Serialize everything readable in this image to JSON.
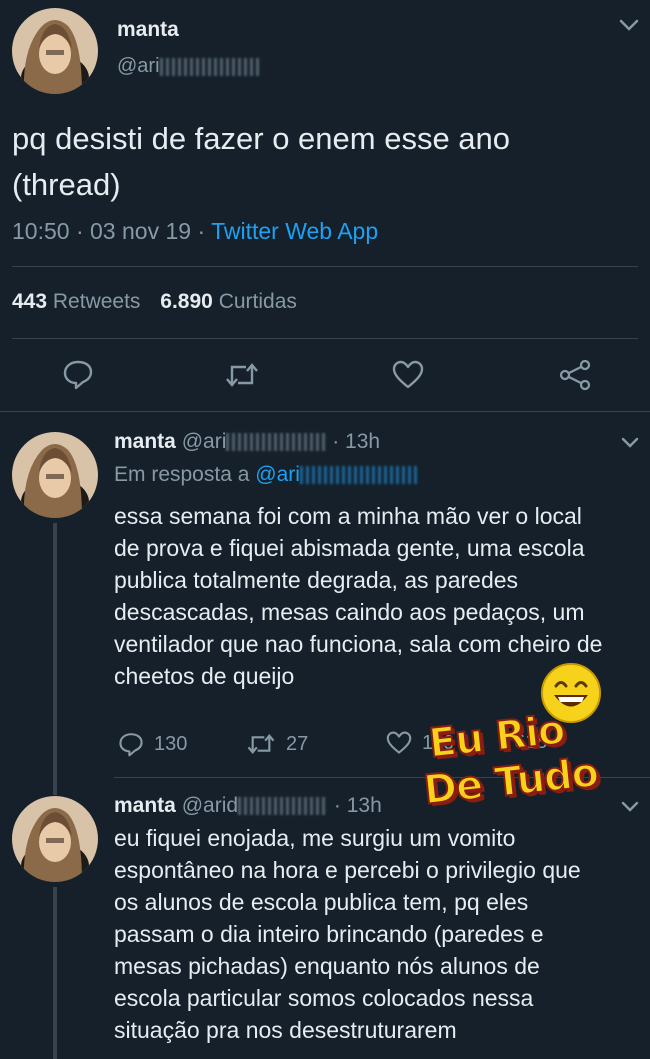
{
  "main_tweet": {
    "name": "manta",
    "handle": "@ari",
    "text_line1": "pq desisti de fazer o enem esse ano",
    "text_line2": "(thread)",
    "time": "10:50",
    "date": "03 nov 19",
    "source": "Twitter Web App",
    "retweets_count": "443",
    "retweets_label": "Retweets",
    "likes_count": "6.890",
    "likes_label": "Curtidas",
    "sep": "·"
  },
  "reply1": {
    "name": "manta",
    "handle": "@ari",
    "time": "· 13h",
    "reply_prefix": "Em resposta a",
    "reply_handle": "@ari",
    "lines": [
      "essa semana foi com a minha mão ver o local",
      "de prova e fiquei abismada gente, uma escola",
      "publica totalmente degrada, as paredes",
      "descascadas, mesas caindo aos pedaços, um",
      "ventilador que nao funciona, sala com cheiro de",
      "cheetos de queijo"
    ],
    "replies": "130",
    "retweets": "27",
    "likes": "116",
    "shares": "618"
  },
  "reply2": {
    "name": "manta",
    "handle": "@arid",
    "time": "· 13h",
    "lines": [
      "eu fiquei enojada, me surgiu um vomito",
      "espontâneo na hora e percebi o privilegio que",
      "os alunos de escola publica tem, pq eles",
      "passam o dia inteiro brincando (paredes e",
      "mesas pichadas) enquanto nós alunos de",
      "escola particular somos colocados nessa",
      "situação pra nos desestruturarem"
    ]
  },
  "watermark": {
    "line1": "Eu Rio",
    "line2": "De Tudo"
  },
  "colors": {
    "background": "#15202b",
    "accent": "#1da1f2",
    "muted": "#8899a6",
    "watermark_yellow": "#f7d21a",
    "watermark_red": "#c0392b"
  }
}
